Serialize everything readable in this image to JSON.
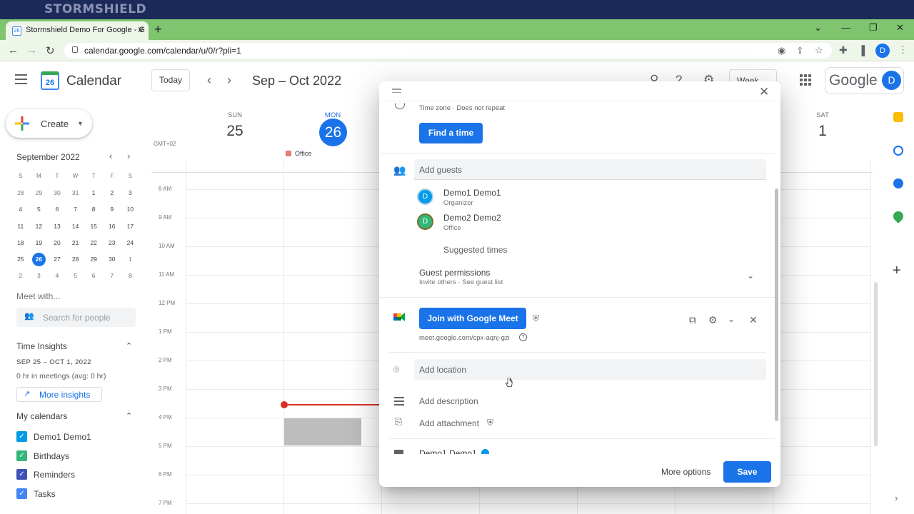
{
  "banner": {
    "brand": "STORMSHIELD"
  },
  "browser": {
    "tab_title": "Stormshield Demo For Google - G",
    "tab_favicon": "26",
    "url": "calendar.google.com/calendar/u/0/r?pli=1",
    "profile_initial": "D"
  },
  "header": {
    "app_title": "Calendar",
    "logo_day": "26",
    "today_label": "Today",
    "date_range": "Sep – Oct 2022",
    "view_label": "Week",
    "google_word": "Google",
    "avatar_initial": "D"
  },
  "sidebar": {
    "create_label": "Create",
    "mini_month": "September 2022",
    "weekday_letters": [
      "S",
      "M",
      "T",
      "W",
      "T",
      "F",
      "S"
    ],
    "mini_weeks": [
      [
        "28",
        "29",
        "30",
        "31",
        "1",
        "2",
        "3"
      ],
      [
        "4",
        "5",
        "6",
        "7",
        "8",
        "9",
        "10"
      ],
      [
        "11",
        "12",
        "13",
        "14",
        "15",
        "16",
        "17"
      ],
      [
        "18",
        "19",
        "20",
        "21",
        "22",
        "23",
        "24"
      ],
      [
        "25",
        "26",
        "27",
        "28",
        "29",
        "30",
        "1"
      ],
      [
        "2",
        "3",
        "4",
        "5",
        "6",
        "7",
        "8"
      ]
    ],
    "selected_day": "26",
    "meet_with": "Meet with...",
    "search_people_placeholder": "Search for people",
    "time_insights_title": "Time Insights",
    "time_insights_range": "SEP 25 – OCT 1, 2022",
    "time_insights_meetings": "0 hr in meetings (avg: 0 hr)",
    "more_insights": "More insights",
    "my_calendars_title": "My calendars",
    "calendars": [
      {
        "label": "Demo1 Demo1",
        "color": "#039be5"
      },
      {
        "label": "Birthdays",
        "color": "#33b679"
      },
      {
        "label": "Reminders",
        "color": "#3f51b5"
      },
      {
        "label": "Tasks",
        "color": "#4285f4"
      }
    ]
  },
  "week": {
    "tz": "GMT+02",
    "days": [
      {
        "dow": "SUN",
        "num": "25"
      },
      {
        "dow": "MON",
        "num": "26"
      },
      {
        "dow": "SAT",
        "num": "1"
      }
    ],
    "allday_event": "Office",
    "times": [
      "8 AM",
      "9 AM",
      "10 AM",
      "11 AM",
      "12 PM",
      "1 PM",
      "2 PM",
      "3 PM",
      "4 PM",
      "5 PM",
      "6 PM",
      "7 PM"
    ]
  },
  "dialog": {
    "tz_line": "Time zone · Does not repeat",
    "find_time": "Find a time",
    "add_guests_placeholder": "Add guests",
    "guests": [
      {
        "initial": "D",
        "name": "Demo1 Demo1",
        "role": "Organizer",
        "color": "#039be5",
        "ring": "#a8d1ee"
      },
      {
        "initial": "D",
        "name": "Demo2 Demo2",
        "role": "Office",
        "color": "#33b679",
        "ring": "#7a6c2a"
      }
    ],
    "suggested_times": "Suggested times",
    "guest_permissions_title": "Guest permissions",
    "guest_permissions_sub": "Invite others · See guest list",
    "join_meet": "Join with Google Meet",
    "meet_link": "meet.google.com/cpx-aqnj-gzi",
    "add_location_placeholder": "Add location",
    "add_description": "Add description",
    "add_attachment": "Add attachment",
    "owner_name": "Demo1 Demo1",
    "more_options": "More options",
    "save": "Save"
  }
}
